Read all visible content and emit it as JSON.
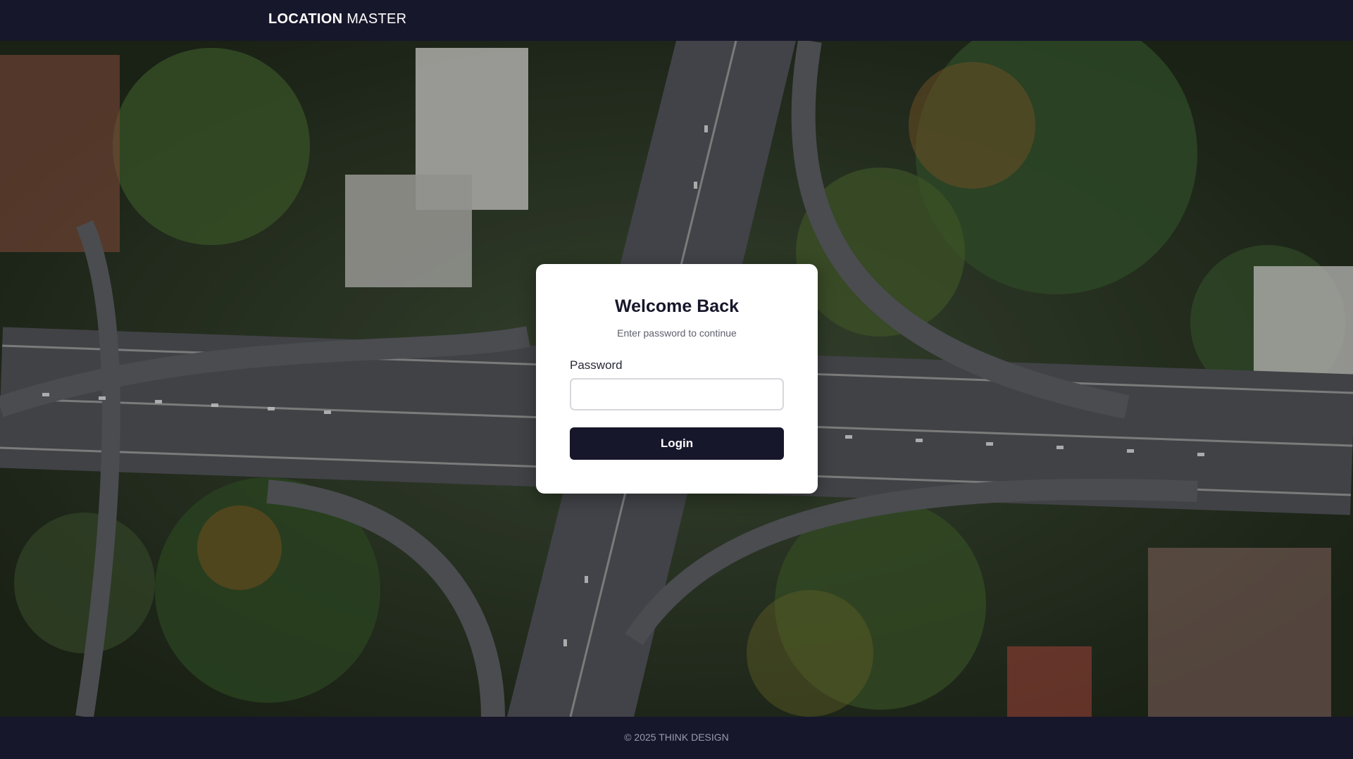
{
  "header": {
    "brand_bold": "LOCATION",
    "brand_light": "MASTER"
  },
  "hero": {
    "description_icon": "aerial-highway-photo"
  },
  "login": {
    "title": "Welcome Back",
    "subtitle": "Enter password to continue",
    "password_label": "Password",
    "password_value": "",
    "password_placeholder": "",
    "button_label": "Login"
  },
  "footer": {
    "copyright": "© 2025 THINK DESIGN"
  },
  "colors": {
    "navy": "#17172b",
    "card": "#ffffff",
    "input_border": "#d7d7dd"
  }
}
